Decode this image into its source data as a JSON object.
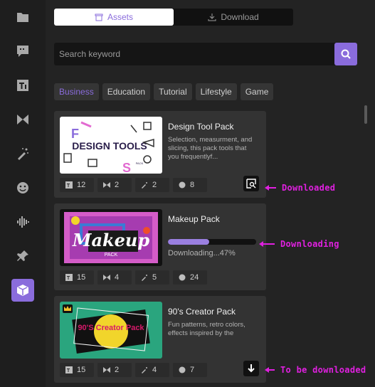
{
  "tabs": {
    "assets_label": "Assets",
    "download_label": "Download"
  },
  "search": {
    "placeholder": "Search keyword"
  },
  "categories": [
    "Business",
    "Education",
    "Tutorial",
    "Lifestyle",
    "Game"
  ],
  "sidebar": {
    "items": [
      {
        "icon": "folder-icon"
      },
      {
        "icon": "chat-icon"
      },
      {
        "icon": "text-icon"
      },
      {
        "icon": "transition-icon"
      },
      {
        "icon": "magic-wand-icon"
      },
      {
        "icon": "sticker-icon"
      },
      {
        "icon": "audio-icon"
      },
      {
        "icon": "pin-icon"
      },
      {
        "icon": "box-icon",
        "active": true
      }
    ]
  },
  "packs": [
    {
      "title": "Design Tool Pack",
      "description": "Selection, measurment, and slicing, this pack tools that you frequentlyf...",
      "thumb_text": "DESIGN TOOLS",
      "thumb_sub": "PACK",
      "stats": {
        "text": "12",
        "transition": "2",
        "effect": "2",
        "sticker": "8"
      },
      "state": "downloaded"
    },
    {
      "title": "Makeup Pack",
      "thumb_text": "Makeup",
      "thumb_sub": "PACK",
      "progress": 0.47,
      "progress_text": "Downloading...47%",
      "stats": {
        "text": "15",
        "transition": "4",
        "effect": "5",
        "sticker": "24"
      },
      "state": "downloading"
    },
    {
      "title": "90's Creator Pack",
      "description": "Fun patterns, retro colors, effects inspired by the",
      "thumb_text": "90'S Creator Pack",
      "stats": {
        "text": "15",
        "transition": "2",
        "effect": "4",
        "sticker": "7"
      },
      "state": "to_be_downloaded"
    }
  ],
  "annotations": {
    "downloaded": "Downloaded",
    "downloading": "Downloading",
    "to_be_downloaded": "To be downloaded"
  },
  "colors": {
    "accent": "#8a6cdc",
    "annotation": "#e020e0",
    "background": "#232323",
    "card": "#333333"
  }
}
